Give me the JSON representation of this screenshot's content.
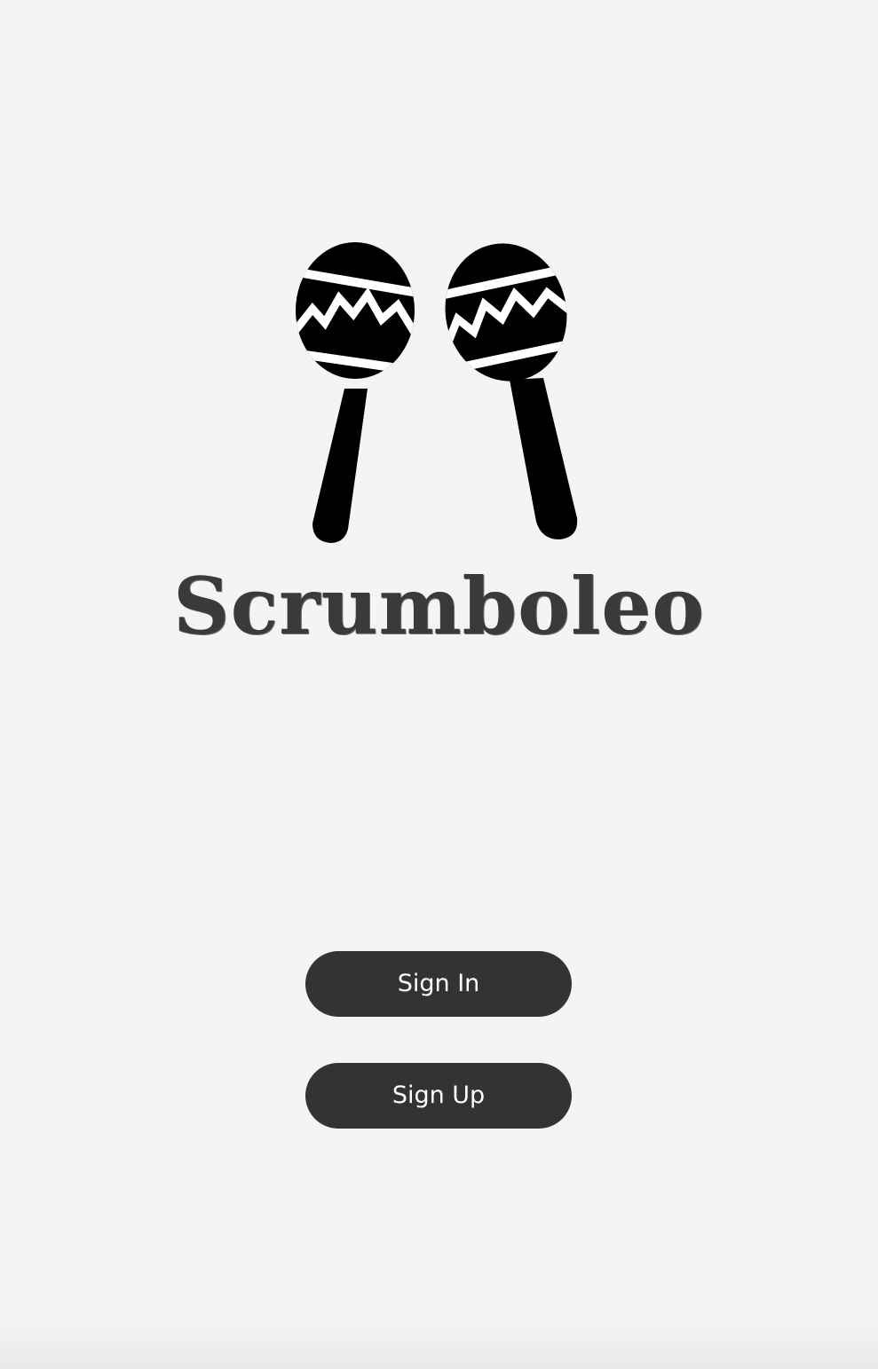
{
  "app": {
    "name": "Scrumboleo",
    "logo_icon": "maracas-icon"
  },
  "actions": {
    "sign_in_label": "Sign In",
    "sign_up_label": "Sign Up"
  },
  "colors": {
    "background": "#f4f4f4",
    "button": "#333333",
    "button_text": "#ffffff",
    "logo": "#000000"
  }
}
